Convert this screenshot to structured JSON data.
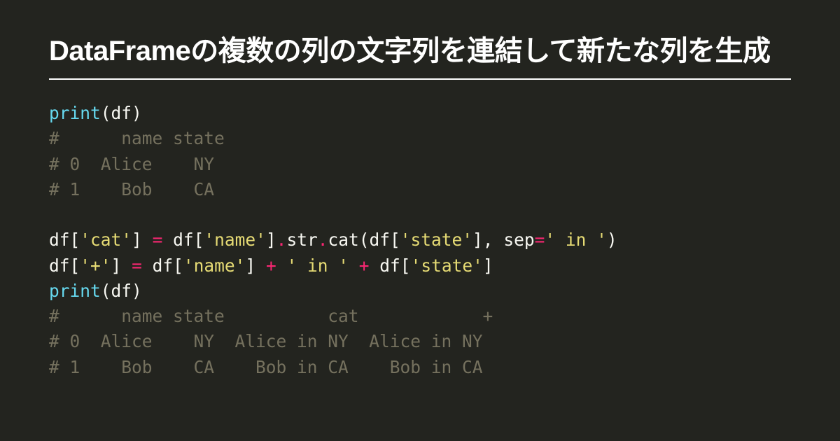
{
  "title": "DataFrameの複数の列の文字列を連結して新たな列を生成",
  "chart_data": {
    "type": "table",
    "input": {
      "columns": [
        "name",
        "state"
      ],
      "rows": [
        {
          "index": 0,
          "name": "Alice",
          "state": "NY"
        },
        {
          "index": 1,
          "name": "Bob",
          "state": "CA"
        }
      ]
    },
    "operations": [
      "df['cat'] = df['name'].str.cat(df['state'], sep=' in ')",
      "df['+'] = df['name'] + ' in ' + df['state']"
    ],
    "output": {
      "columns": [
        "name",
        "state",
        "cat",
        "+"
      ],
      "rows": [
        {
          "index": 0,
          "name": "Alice",
          "state": "NY",
          "cat": "Alice in NY",
          "+": "Alice in NY"
        },
        {
          "index": 1,
          "name": "Bob",
          "state": "CA",
          "cat": "Bob in CA",
          "+": "Bob in CA"
        }
      ]
    }
  },
  "code": {
    "l1_fn": "print",
    "l1_arg": "df",
    "c2": "#      name state",
    "c3": "# 0  Alice    NY",
    "c4": "# 1    Bob    CA",
    "l6_df": "df",
    "l6_s_cat": "'cat'",
    "l6_s_name": "'name'",
    "l6_s_state": "'state'",
    "l6_s_sep": "' in '",
    "l6_str": "str",
    "l6_cat": "cat",
    "l6_sep": "sep",
    "l7_s_plus": "'+'",
    "l7_s_in": "' in '",
    "c9": "#      name state          cat            +",
    "c10": "# 0  Alice    NY  Alice in NY  Alice in NY",
    "c11": "# 1    Bob    CA    Bob in CA    Bob in CA"
  }
}
